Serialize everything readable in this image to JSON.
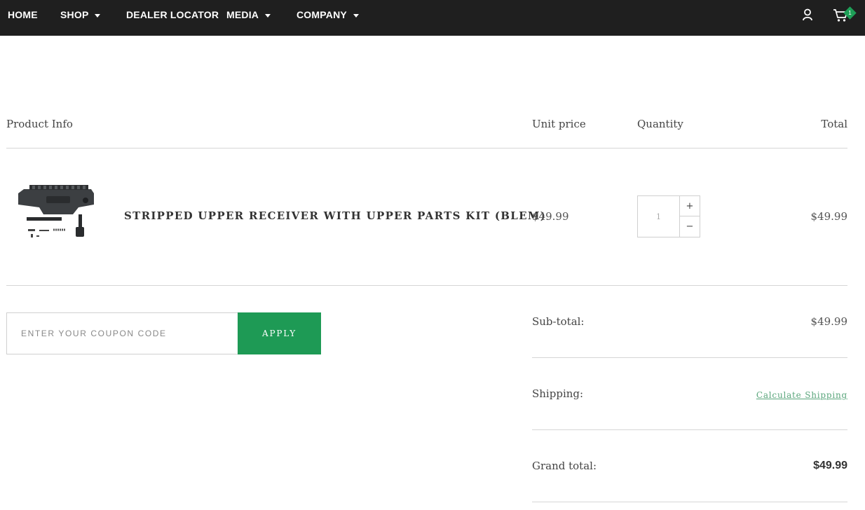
{
  "nav": {
    "items": [
      {
        "label": "HOME"
      },
      {
        "label": "SHOP"
      },
      {
        "label": "DEALER LOCATOR"
      },
      {
        "label": "MEDIA"
      },
      {
        "label": "COMPANY"
      }
    ],
    "cart_count": "1",
    "icons": [
      "user-icon",
      "cart-icon"
    ]
  },
  "table": {
    "headers": {
      "product": "Product Info",
      "unit_price": "Unit price",
      "quantity": "Quantity",
      "total": "Total"
    },
    "rows": [
      {
        "name": "STRIPPED UPPER RECEIVER WITH UPPER PARTS KIT (BLEM)",
        "unit_price": "$49.99",
        "quantity": "1",
        "total": "$49.99",
        "plus": "+",
        "minus": "−"
      }
    ]
  },
  "coupon": {
    "placeholder": "ENTER YOUR COUPON CODE",
    "apply_label": "APPLY"
  },
  "totals": {
    "subtotal_label": "Sub-total:",
    "subtotal_value": "$49.99",
    "shipping_label": "Shipping:",
    "shipping_link": "Calculate Shipping",
    "grand_label": "Grand total:",
    "grand_value": "$49.99"
  },
  "colors": {
    "nav_bg": "#1f1f1f",
    "accent_green": "#1e9a55",
    "link_green": "#5aa67c"
  }
}
